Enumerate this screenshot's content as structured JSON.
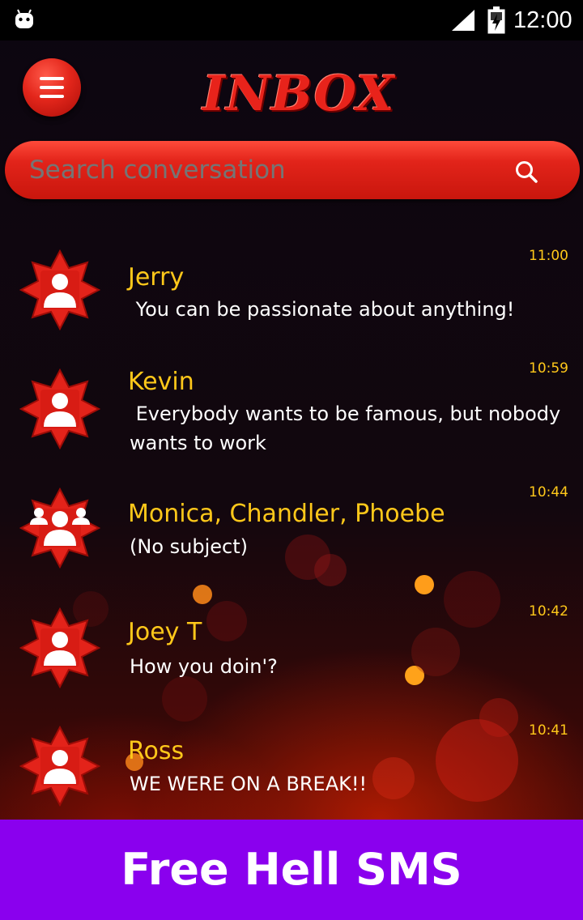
{
  "status_bar": {
    "time": "12:00",
    "icons": [
      "android-notification-icon",
      "signal-icon",
      "battery-charging-icon"
    ]
  },
  "header": {
    "title": "INBOX",
    "menu_icon": "hamburger-menu-icon"
  },
  "search": {
    "placeholder": "Search conversation",
    "icon": "search-icon"
  },
  "conversations": [
    {
      "name": "Jerry",
      "snippet": " You can be passionate about anything!",
      "time": "11:00",
      "avatar": "single-contact-icon"
    },
    {
      "name": "Kevin",
      "snippet": " Everybody wants to be famous, but nobody wants to work",
      "time": "10:59",
      "avatar": "single-contact-icon"
    },
    {
      "name": "Monica, Chandler, Phoebe",
      "snippet": "(No subject)",
      "time": "10:44",
      "avatar": "group-contact-icon"
    },
    {
      "name": "Joey T",
      "snippet": "How you doin'?",
      "time": "10:42",
      "avatar": "single-contact-icon"
    },
    {
      "name": "Ross",
      "snippet": "WE WERE ON A BREAK!!",
      "time": "10:41",
      "avatar": "single-contact-icon"
    }
  ],
  "banner": {
    "text": "Free Hell SMS",
    "color": "#8a00ee"
  },
  "colors": {
    "accent_red": "#e2241a",
    "name_yellow": "#ffc81a",
    "background": "#0e0612"
  }
}
